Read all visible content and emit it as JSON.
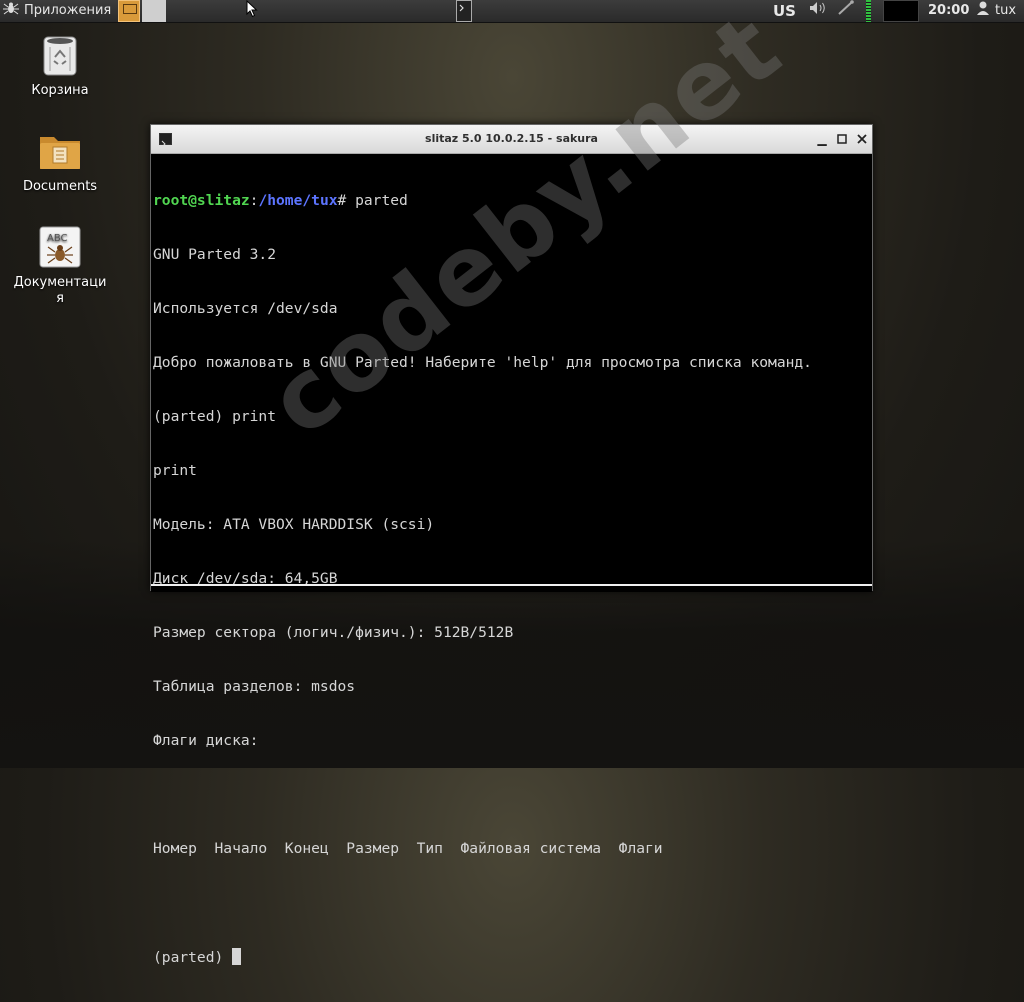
{
  "panel": {
    "apps_label": "Приложения",
    "keyboard_layout": "US",
    "clock": "20:00",
    "user": "tux"
  },
  "desktop": {
    "icons": [
      {
        "label": "Корзина",
        "icon": "trash-icon"
      },
      {
        "label": "Documents",
        "icon": "folder-icon"
      },
      {
        "label": "Документация",
        "icon": "documentation-icon"
      }
    ]
  },
  "terminal": {
    "title": "slitaz 5.0 10.0.2.15  - sakura",
    "prompt_user": "root@slitaz",
    "prompt_sep": ":",
    "prompt_path": "/home/tux",
    "prompt_end": "# parted",
    "lines": [
      "GNU Parted 3.2",
      "Используется /dev/sda",
      "Добро пожаловать в GNU Parted! Наберите 'help' для просмотра списка команд.",
      "(parted) print",
      "print",
      "Модель: ATA VBOX HARDDISK (scsi)",
      "Диск /dev/sda: 64,5GB",
      "Размер сектора (логич./физич.): 512B/512B",
      "Таблица разделов: msdos",
      "Флаги диска:",
      "",
      "Номер  Начало  Конец  Размер  Тип  Файловая система  Флаги",
      ""
    ],
    "current_prompt": "(parted) "
  },
  "watermark": "codeby.net",
  "colors": {
    "prompt_user": "#51d651",
    "prompt_path": "#5c74ff",
    "terminal_bg": "#000000",
    "terminal_fg": "#d6d6d6"
  }
}
